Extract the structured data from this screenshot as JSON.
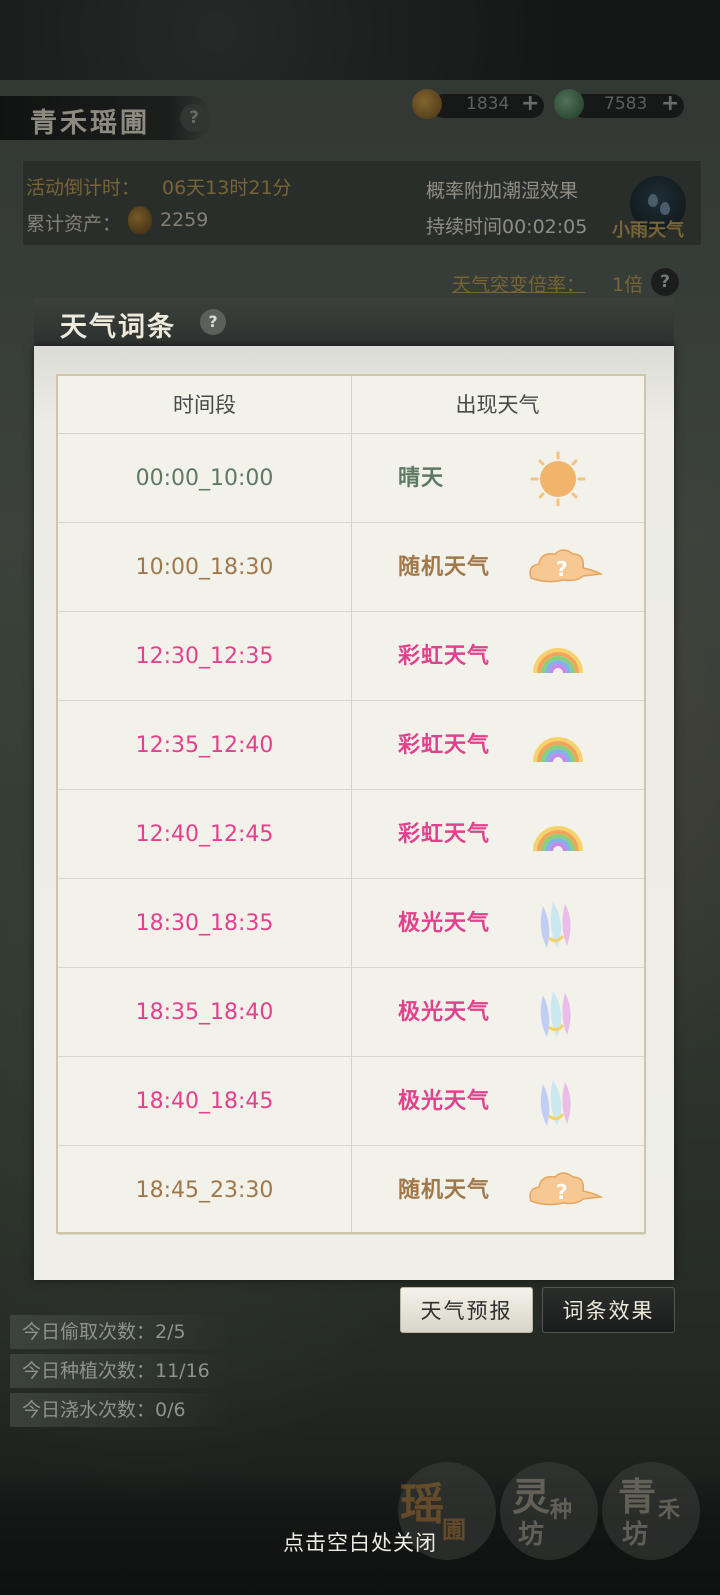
{
  "header": {
    "title": "青禾瑶圃",
    "help": "?",
    "currency1": "1834",
    "currency2": "7583",
    "plus": "+"
  },
  "info": {
    "countdown_label": "活动倒计时：",
    "countdown_value": "06天13时21分",
    "assets_label": "累计资产：",
    "assets_value": "2259",
    "effect_text": "概率附加潮湿效果",
    "duration_text": "持续时间00:02:05",
    "current_weather": "小雨天气",
    "mutation_label": "天气突变倍率：",
    "mutation_value": "1倍"
  },
  "modal": {
    "title": "天气词条",
    "help": "?",
    "col_time": "时间段",
    "col_weather": "出现天气",
    "rows": [
      {
        "time": "00:00_10:00",
        "weather": "晴天",
        "icon": "sun-icon",
        "color": "#5f7a63"
      },
      {
        "time": "10:00_18:30",
        "weather": "随机天气",
        "icon": "cloud-question-icon",
        "color": "#a0784a"
      },
      {
        "time": "12:30_12:35",
        "weather": "彩虹天气",
        "icon": "rainbow-icon",
        "color": "#e2418e"
      },
      {
        "time": "12:35_12:40",
        "weather": "彩虹天气",
        "icon": "rainbow-icon",
        "color": "#e2418e"
      },
      {
        "time": "12:40_12:45",
        "weather": "彩虹天气",
        "icon": "rainbow-icon",
        "color": "#e2418e"
      },
      {
        "time": "18:30_18:35",
        "weather": "极光天气",
        "icon": "aurora-icon",
        "color": "#e2418e"
      },
      {
        "time": "18:35_18:40",
        "weather": "极光天气",
        "icon": "aurora-icon",
        "color": "#e2418e"
      },
      {
        "time": "18:40_18:45",
        "weather": "极光天气",
        "icon": "aurora-icon",
        "color": "#e2418e"
      },
      {
        "time": "18:45_23:30",
        "weather": "随机天气",
        "icon": "cloud-question-icon",
        "color": "#a0784a"
      }
    ]
  },
  "buttons": {
    "forecast": "天气预报",
    "effects": "词条效果"
  },
  "stats": {
    "steal": "今日偷取次数：2/5",
    "plant": "今日种植次数：11/16",
    "water": "今日浇水次数：0/6"
  },
  "bottom_nav": {
    "yaopu_big": "瑶",
    "yaopu_small": "圃",
    "lingzhong_big": "灵",
    "lingzhong_mid": "种",
    "lingzhong_small": "坊",
    "qinghe_big": "青",
    "qinghe_mid": "禾",
    "qinghe_small": "坊"
  },
  "close_hint": "点击空白处关闭"
}
